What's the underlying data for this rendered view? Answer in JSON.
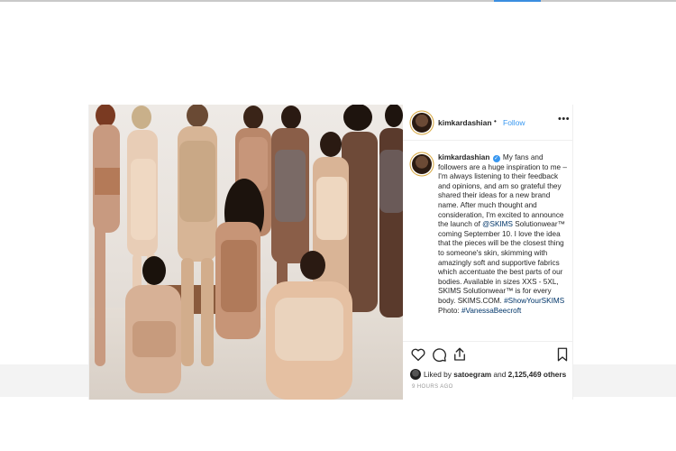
{
  "post": {
    "username": "kimkardashian",
    "separator": "•",
    "follow_label": "Follow",
    "more_label": "•••",
    "caption": {
      "username": "kimkardashian",
      "text_1": "My fans and followers are a huge inspiration to me – I'm always listening to their feedback and opinions, and am so grateful they shared their ideas for a new brand name. After much thought and consideration, I'm excited to announce the launch of ",
      "mention": "@SKIMS",
      "text_2": " Solutionwear™ coming September 10. I love the idea that the pieces will be the closest thing to someone's skin, skimming with amazingly soft and supportive fabrics which accentuate the best parts of our bodies.  Available in sizes XXS - 5XL, SKIMS Solutionwear™ is for every body. SKIMS.COM. ",
      "hashtag": "#ShowYourSKIMS",
      "text_3": " Photo: ",
      "photo_credit": "#VanessaBeecroft"
    },
    "likes": {
      "prefix": "Liked by ",
      "liker": "satoegram",
      "middle": " and ",
      "count": "2,125,469 others"
    },
    "time_ago": "9 HOURS AGO"
  },
  "colors": {
    "link_blue": "#3897f0",
    "hashtag_blue": "#003569",
    "text": "#262626",
    "muted": "#999999"
  },
  "icons": [
    "heart-icon",
    "comment-icon",
    "share-icon",
    "bookmark-icon",
    "verified-badge-icon",
    "more-options-icon"
  ]
}
